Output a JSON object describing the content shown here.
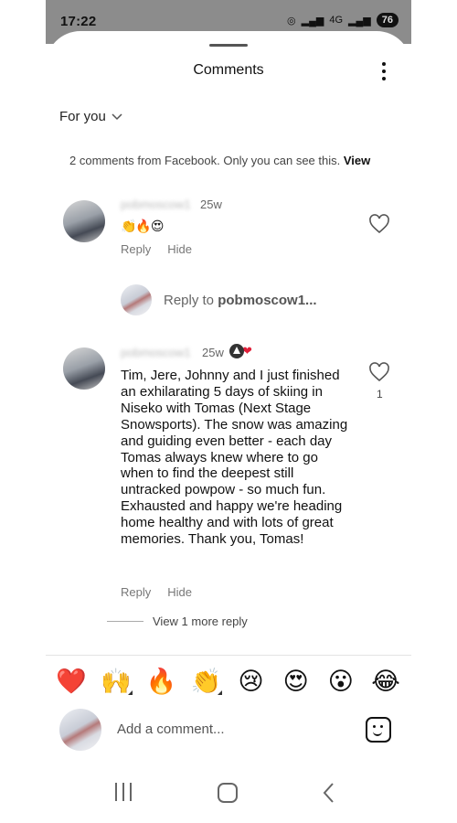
{
  "status_bar": {
    "time": "17:22",
    "signal_text": "4G",
    "battery": "76"
  },
  "header": {
    "title": "Comments"
  },
  "filter": {
    "label": "For you"
  },
  "facebook_notice": {
    "text": "2 comments from Facebook. Only you can see this.",
    "link": "View"
  },
  "comments": [
    {
      "username": "pobmoscow1",
      "time_ago": "25w",
      "emojis": "👏🔥😍",
      "reply_label": "Reply",
      "hide_label": "Hide"
    },
    {
      "username": "pobmoscow1",
      "time_ago": "25w",
      "text": "Tim, Jere, Johnny and I just finished an exhilarating 5 days of skiing in Niseko with Tomas (Next Stage Snowsports). The snow was amazing and guiding even better - each day Tomas always knew where to go when to find the deepest still untracked powpow - so much fun. Exhausted and happy we're heading home healthy and with lots of great memories. Thank you, Tomas!",
      "like_count": "1",
      "reply_label": "Reply",
      "hide_label": "Hide",
      "view_more_replies": "View 1 more reply"
    }
  ],
  "reply_input": {
    "prefix": "Reply to ",
    "target": "pobmoscow1..."
  },
  "quick_emojis": [
    "❤️",
    "🙌",
    "🔥",
    "👏",
    "😢",
    "😍",
    "😮",
    "😂"
  ],
  "comment_input": {
    "placeholder": "Add a comment..."
  },
  "colors": {
    "status_bar_bg": "#8c8c8c",
    "heart_reaction": "#e0203a",
    "text_primary": "#111111",
    "text_secondary": "#777777"
  }
}
